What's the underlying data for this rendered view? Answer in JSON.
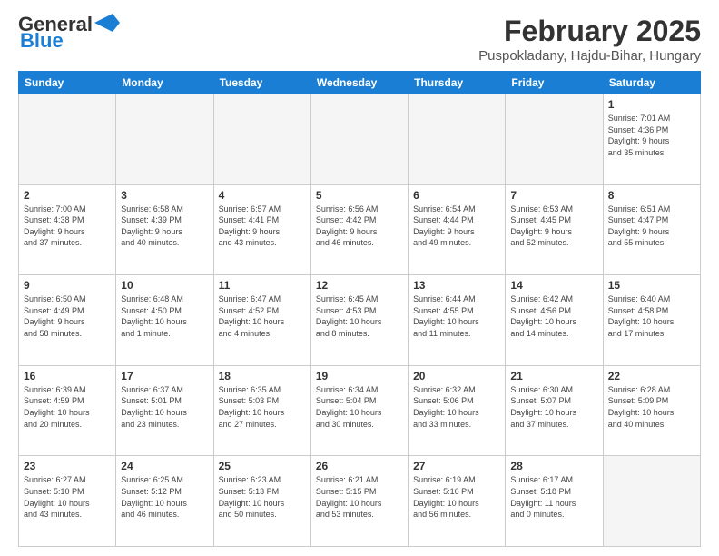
{
  "logo": {
    "text1": "General",
    "text2": "Blue"
  },
  "header": {
    "month": "February 2025",
    "location": "Puspokladany, Hajdu-Bihar, Hungary"
  },
  "weekdays": [
    "Sunday",
    "Monday",
    "Tuesday",
    "Wednesday",
    "Thursday",
    "Friday",
    "Saturday"
  ],
  "weeks": [
    [
      {
        "day": "",
        "info": ""
      },
      {
        "day": "",
        "info": ""
      },
      {
        "day": "",
        "info": ""
      },
      {
        "day": "",
        "info": ""
      },
      {
        "day": "",
        "info": ""
      },
      {
        "day": "",
        "info": ""
      },
      {
        "day": "1",
        "info": "Sunrise: 7:01 AM\nSunset: 4:36 PM\nDaylight: 9 hours\nand 35 minutes."
      }
    ],
    [
      {
        "day": "2",
        "info": "Sunrise: 7:00 AM\nSunset: 4:38 PM\nDaylight: 9 hours\nand 37 minutes."
      },
      {
        "day": "3",
        "info": "Sunrise: 6:58 AM\nSunset: 4:39 PM\nDaylight: 9 hours\nand 40 minutes."
      },
      {
        "day": "4",
        "info": "Sunrise: 6:57 AM\nSunset: 4:41 PM\nDaylight: 9 hours\nand 43 minutes."
      },
      {
        "day": "5",
        "info": "Sunrise: 6:56 AM\nSunset: 4:42 PM\nDaylight: 9 hours\nand 46 minutes."
      },
      {
        "day": "6",
        "info": "Sunrise: 6:54 AM\nSunset: 4:44 PM\nDaylight: 9 hours\nand 49 minutes."
      },
      {
        "day": "7",
        "info": "Sunrise: 6:53 AM\nSunset: 4:45 PM\nDaylight: 9 hours\nand 52 minutes."
      },
      {
        "day": "8",
        "info": "Sunrise: 6:51 AM\nSunset: 4:47 PM\nDaylight: 9 hours\nand 55 minutes."
      }
    ],
    [
      {
        "day": "9",
        "info": "Sunrise: 6:50 AM\nSunset: 4:49 PM\nDaylight: 9 hours\nand 58 minutes."
      },
      {
        "day": "10",
        "info": "Sunrise: 6:48 AM\nSunset: 4:50 PM\nDaylight: 10 hours\nand 1 minute."
      },
      {
        "day": "11",
        "info": "Sunrise: 6:47 AM\nSunset: 4:52 PM\nDaylight: 10 hours\nand 4 minutes."
      },
      {
        "day": "12",
        "info": "Sunrise: 6:45 AM\nSunset: 4:53 PM\nDaylight: 10 hours\nand 8 minutes."
      },
      {
        "day": "13",
        "info": "Sunrise: 6:44 AM\nSunset: 4:55 PM\nDaylight: 10 hours\nand 11 minutes."
      },
      {
        "day": "14",
        "info": "Sunrise: 6:42 AM\nSunset: 4:56 PM\nDaylight: 10 hours\nand 14 minutes."
      },
      {
        "day": "15",
        "info": "Sunrise: 6:40 AM\nSunset: 4:58 PM\nDaylight: 10 hours\nand 17 minutes."
      }
    ],
    [
      {
        "day": "16",
        "info": "Sunrise: 6:39 AM\nSunset: 4:59 PM\nDaylight: 10 hours\nand 20 minutes."
      },
      {
        "day": "17",
        "info": "Sunrise: 6:37 AM\nSunset: 5:01 PM\nDaylight: 10 hours\nand 23 minutes."
      },
      {
        "day": "18",
        "info": "Sunrise: 6:35 AM\nSunset: 5:03 PM\nDaylight: 10 hours\nand 27 minutes."
      },
      {
        "day": "19",
        "info": "Sunrise: 6:34 AM\nSunset: 5:04 PM\nDaylight: 10 hours\nand 30 minutes."
      },
      {
        "day": "20",
        "info": "Sunrise: 6:32 AM\nSunset: 5:06 PM\nDaylight: 10 hours\nand 33 minutes."
      },
      {
        "day": "21",
        "info": "Sunrise: 6:30 AM\nSunset: 5:07 PM\nDaylight: 10 hours\nand 37 minutes."
      },
      {
        "day": "22",
        "info": "Sunrise: 6:28 AM\nSunset: 5:09 PM\nDaylight: 10 hours\nand 40 minutes."
      }
    ],
    [
      {
        "day": "23",
        "info": "Sunrise: 6:27 AM\nSunset: 5:10 PM\nDaylight: 10 hours\nand 43 minutes."
      },
      {
        "day": "24",
        "info": "Sunrise: 6:25 AM\nSunset: 5:12 PM\nDaylight: 10 hours\nand 46 minutes."
      },
      {
        "day": "25",
        "info": "Sunrise: 6:23 AM\nSunset: 5:13 PM\nDaylight: 10 hours\nand 50 minutes."
      },
      {
        "day": "26",
        "info": "Sunrise: 6:21 AM\nSunset: 5:15 PM\nDaylight: 10 hours\nand 53 minutes."
      },
      {
        "day": "27",
        "info": "Sunrise: 6:19 AM\nSunset: 5:16 PM\nDaylight: 10 hours\nand 56 minutes."
      },
      {
        "day": "28",
        "info": "Sunrise: 6:17 AM\nSunset: 5:18 PM\nDaylight: 11 hours\nand 0 minutes."
      },
      {
        "day": "",
        "info": ""
      }
    ]
  ]
}
